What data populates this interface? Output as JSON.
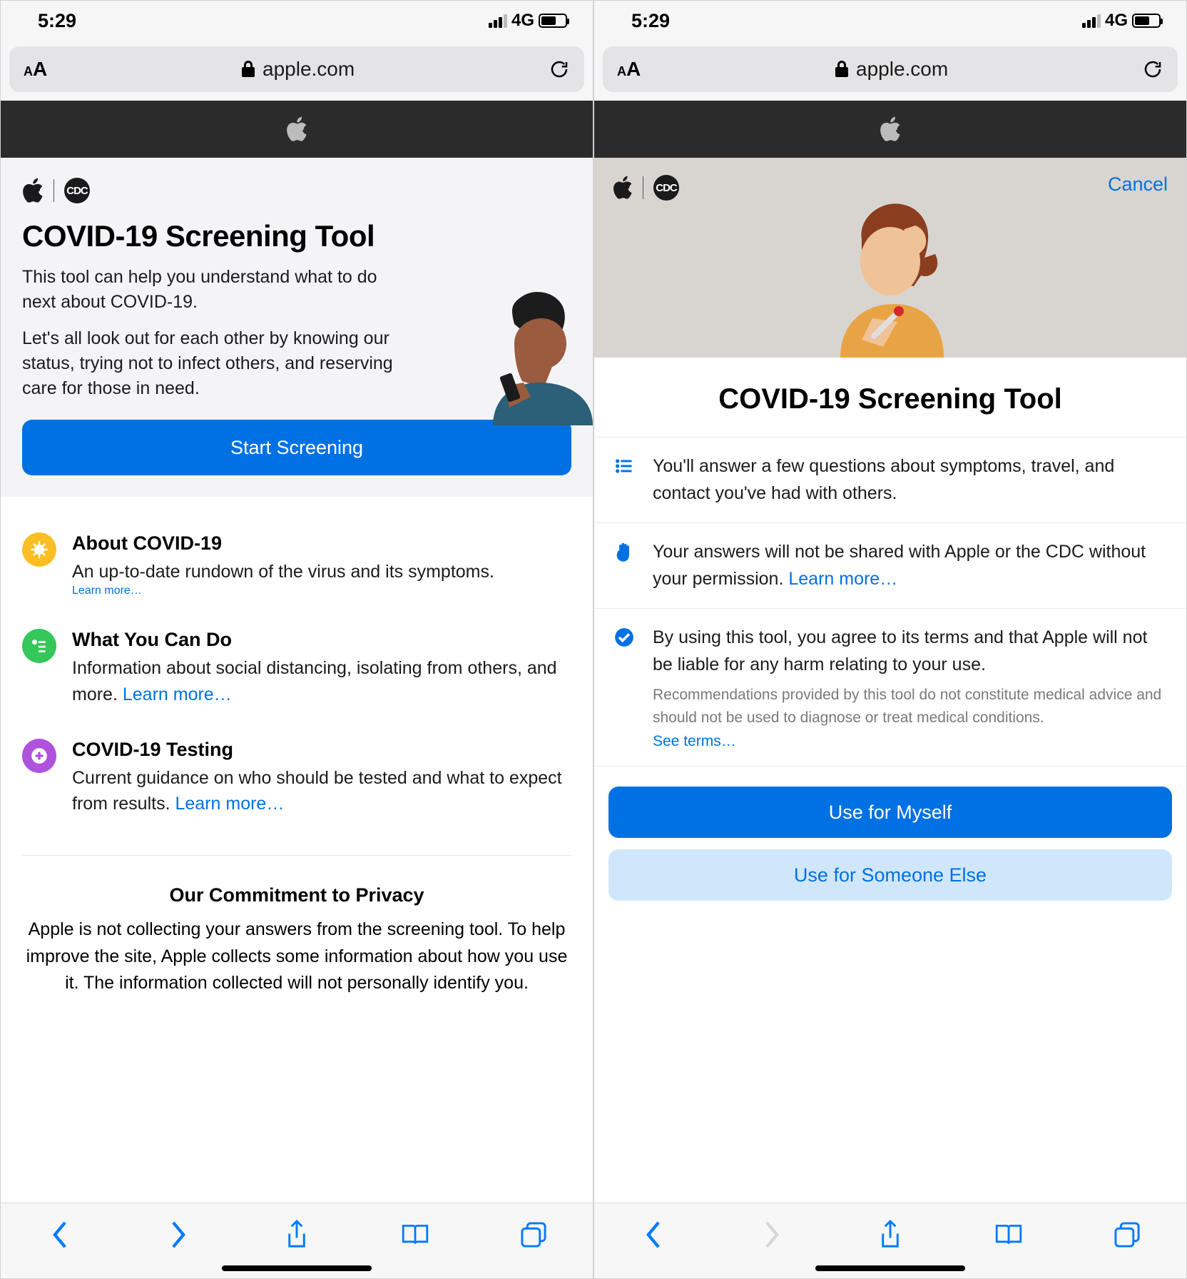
{
  "statusbar": {
    "time": "5:29",
    "net": "4G"
  },
  "urlbar": {
    "domain": "apple.com"
  },
  "left": {
    "title": "COVID-19 Screening Tool",
    "p1": "This tool can help you understand what to do next about COVID-19.",
    "p2": "Let's all look out for each other by knowing our status, trying not to infect others, and reserving care for those in need.",
    "start_button": "Start Screening",
    "items": [
      {
        "title": "About COVID-19",
        "body": "An up-to-date rundown of the virus and its symptoms.",
        "link": "Learn more…"
      },
      {
        "title": "What You Can Do",
        "body": "Information about social distancing, isolating from others, and more. ",
        "link": "Learn more…"
      },
      {
        "title": "COVID-19 Testing",
        "body": "Current guidance on who should be tested and what to expect from results. ",
        "link": "Learn more…"
      }
    ],
    "privacy_title": "Our Commitment to Privacy",
    "privacy_body": "Apple is not collecting your answers from the screening tool. To help improve the site, Apple collects some information about how you use it. The information collected will not personally identify you."
  },
  "right": {
    "cancel": "Cancel",
    "title": "COVID-19 Screening Tool",
    "steps": [
      {
        "text": "You'll answer a few questions about symptoms, travel, and contact you've had with others."
      },
      {
        "text": "Your answers will not be shared with Apple or the CDC without your permission. ",
        "link": "Learn more…"
      },
      {
        "text": "By using this tool, you agree to its terms and that Apple will not be liable for any harm relating to your use.",
        "fine": "Recommendations provided by this tool do not constitute medical advice and should not be used to diagnose or treat medical conditions.",
        "terms": "See terms…"
      }
    ],
    "btn_myself": "Use for Myself",
    "btn_else": "Use for Someone Else"
  }
}
